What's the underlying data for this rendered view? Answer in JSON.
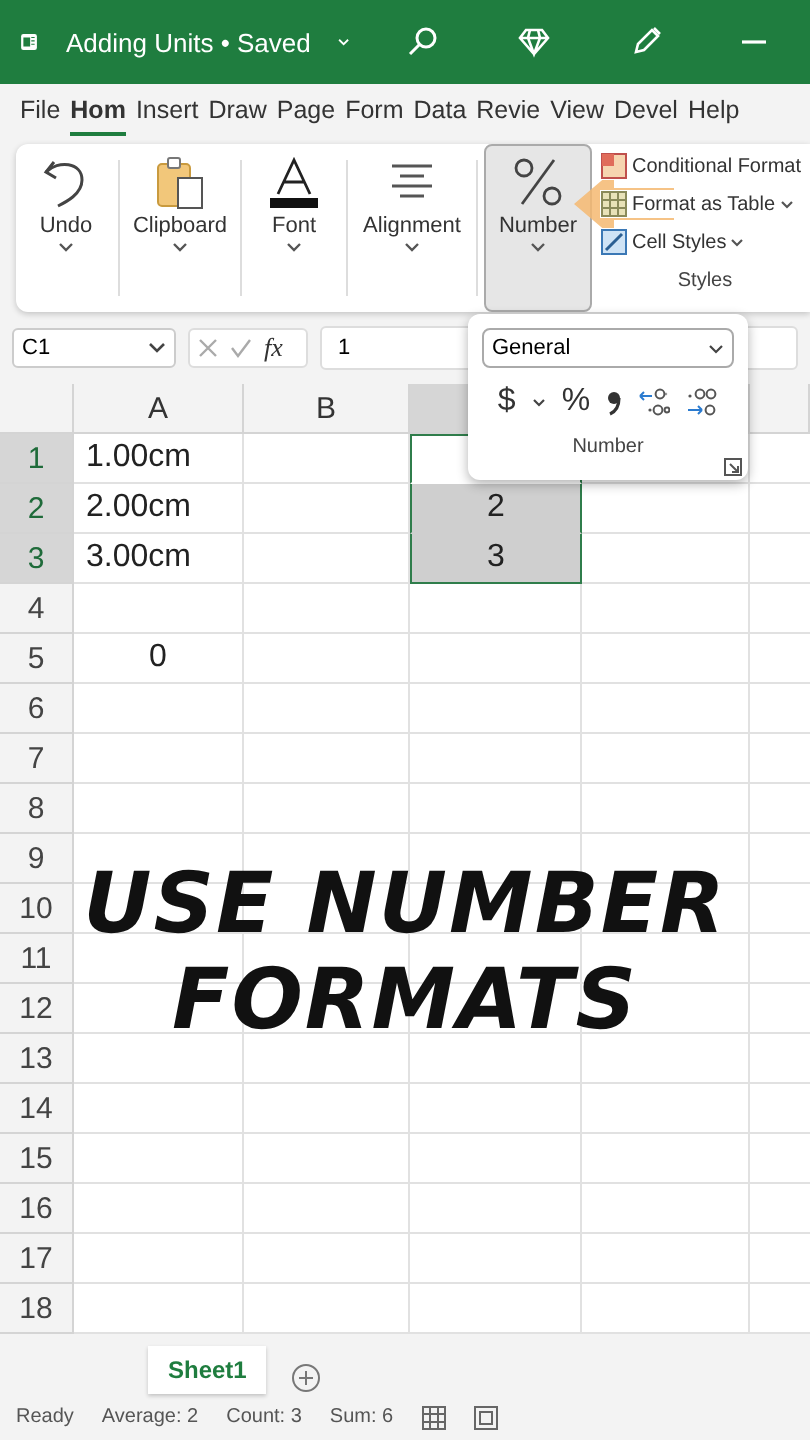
{
  "title_bar": {
    "title": "Adding Units • Saved"
  },
  "ribbon_tabs": [
    {
      "label": "File",
      "selected": false
    },
    {
      "label": "Hom",
      "selected": true
    },
    {
      "label": "Insert",
      "selected": false
    },
    {
      "label": "Draw",
      "selected": false
    },
    {
      "label": "Page",
      "selected": false
    },
    {
      "label": "Form",
      "selected": false
    },
    {
      "label": "Data",
      "selected": false
    },
    {
      "label": "Revie",
      "selected": false
    },
    {
      "label": "View",
      "selected": false
    },
    {
      "label": "Devel",
      "selected": false
    },
    {
      "label": "Help",
      "selected": false
    }
  ],
  "ribbon_groups": [
    {
      "label": "Undo",
      "kind": "undo",
      "pressed": false
    },
    {
      "label": "Clipboard",
      "kind": "clipboard",
      "pressed": false
    },
    {
      "label": "Font",
      "kind": "font",
      "pressed": false
    },
    {
      "label": "Alignment",
      "kind": "alignment",
      "pressed": false
    },
    {
      "label": "Number",
      "kind": "number",
      "pressed": true
    }
  ],
  "styles_group": {
    "items": [
      {
        "label": "Conditional Format",
        "kind": "conditional"
      },
      {
        "label": "Format as Table",
        "kind": "table",
        "dropdown": true
      },
      {
        "label": "Cell Styles",
        "kind": "styles",
        "dropdown": true
      }
    ],
    "label": "Styles"
  },
  "number_popup": {
    "format": "General",
    "currency": "$",
    "percent": "%",
    "label": "Number"
  },
  "formula_bar": {
    "name_box": "C1",
    "fx": "fx",
    "value": "1"
  },
  "sheet": {
    "columns": [
      {
        "label": "A"
      },
      {
        "label": "B"
      }
    ],
    "rows": [
      {
        "number": "1",
        "selected": true,
        "cells": {
          "A": "1.00cm"
        }
      },
      {
        "number": "2",
        "selected": true,
        "cells": {
          "A": "2.00cm",
          "C": "2"
        }
      },
      {
        "number": "3",
        "selected": true,
        "cells": {
          "A": "3.00cm",
          "C": "3"
        }
      },
      {
        "number": "4",
        "selected": false,
        "cells": {}
      },
      {
        "number": "5",
        "selected": false,
        "cells": {
          "A": "0"
        }
      },
      {
        "number": "6",
        "selected": false,
        "cells": {}
      },
      {
        "number": "7",
        "selected": false,
        "cells": {}
      },
      {
        "number": "8",
        "selected": false,
        "cells": {}
      },
      {
        "number": "9",
        "selected": false,
        "cells": {}
      },
      {
        "number": "10",
        "selected": false,
        "cells": {}
      },
      {
        "number": "11",
        "selected": false,
        "cells": {}
      },
      {
        "number": "12",
        "selected": false,
        "cells": {}
      },
      {
        "number": "13",
        "selected": false,
        "cells": {}
      },
      {
        "number": "14",
        "selected": false,
        "cells": {}
      },
      {
        "number": "15",
        "selected": false,
        "cells": {}
      },
      {
        "number": "16",
        "selected": false,
        "cells": {}
      },
      {
        "number": "17",
        "selected": false,
        "cells": {}
      },
      {
        "number": "18",
        "selected": false,
        "cells": {}
      }
    ]
  },
  "caption": {
    "lines": [
      "USE NUMBER",
      "FORMATS"
    ]
  },
  "sheet_tabs": [
    {
      "label": "Sheet1",
      "selected": true
    }
  ],
  "status_bar": {
    "state": "Ready",
    "stats": [
      "Average: 2",
      "Count: 3",
      "Sum: 6"
    ]
  }
}
